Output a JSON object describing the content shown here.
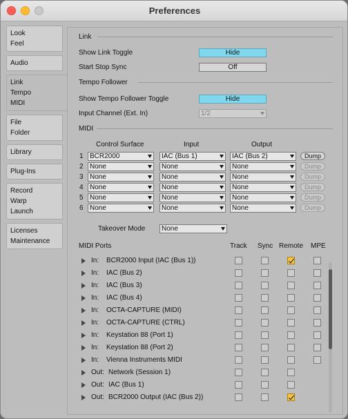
{
  "window": {
    "title": "Preferences"
  },
  "sidebar": {
    "tabs": [
      {
        "lines": [
          "Look",
          "Feel"
        ]
      },
      {
        "lines": [
          "Audio"
        ]
      },
      {
        "lines": [
          "Link",
          "Tempo",
          "MIDI"
        ],
        "active": true
      },
      {
        "lines": [
          "File",
          "Folder"
        ]
      },
      {
        "lines": [
          "Library"
        ]
      },
      {
        "lines": [
          "Plug-Ins"
        ]
      },
      {
        "lines": [
          "Record",
          "Warp",
          "Launch"
        ]
      },
      {
        "lines": [
          "Licenses",
          "Maintenance"
        ]
      }
    ]
  },
  "link": {
    "section": "Link",
    "show_link_toggle_label": "Show Link Toggle",
    "show_link_toggle_value": "Hide",
    "start_stop_sync_label": "Start Stop Sync",
    "start_stop_sync_value": "Off"
  },
  "tempo_follower": {
    "section": "Tempo Follower",
    "show_toggle_label": "Show Tempo Follower Toggle",
    "show_toggle_value": "Hide",
    "input_channel_label": "Input Channel (Ext. In)",
    "input_channel_value": "1/2"
  },
  "midi": {
    "section": "MIDI",
    "col_control_surface": "Control Surface",
    "col_input": "Input",
    "col_output": "Output",
    "dump_label": "Dump",
    "rows": [
      {
        "num": "1",
        "surface": "BCR2000",
        "input": "IAC (Bus 1)",
        "output": "IAC (Bus 2)",
        "dump_enabled": true
      },
      {
        "num": "2",
        "surface": "None",
        "input": "None",
        "output": "None",
        "dump_enabled": false
      },
      {
        "num": "3",
        "surface": "None",
        "input": "None",
        "output": "None",
        "dump_enabled": false
      },
      {
        "num": "4",
        "surface": "None",
        "input": "None",
        "output": "None",
        "dump_enabled": false
      },
      {
        "num": "5",
        "surface": "None",
        "input": "None",
        "output": "None",
        "dump_enabled": false
      },
      {
        "num": "6",
        "surface": "None",
        "input": "None",
        "output": "None",
        "dump_enabled": false
      }
    ],
    "takeover_label": "Takeover Mode",
    "takeover_value": "None"
  },
  "midi_ports": {
    "title": "MIDI Ports",
    "col_track": "Track",
    "col_sync": "Sync",
    "col_remote": "Remote",
    "col_mpe": "MPE",
    "ports": [
      {
        "dir": "In:",
        "name": "BCR2000 Input (IAC (Bus 1))",
        "remote": true,
        "has_mpe": true
      },
      {
        "dir": "In:",
        "name": "IAC (Bus 2)",
        "remote": false,
        "has_mpe": true
      },
      {
        "dir": "In:",
        "name": "IAC (Bus 3)",
        "remote": false,
        "has_mpe": true
      },
      {
        "dir": "In:",
        "name": "IAC (Bus 4)",
        "remote": false,
        "has_mpe": true
      },
      {
        "dir": "In:",
        "name": "OCTA-CAPTURE (MIDI)",
        "remote": false,
        "has_mpe": true
      },
      {
        "dir": "In:",
        "name": "OCTA-CAPTURE (CTRL)",
        "remote": false,
        "has_mpe": true
      },
      {
        "dir": "In:",
        "name": "Keystation 88 (Port 1)",
        "remote": false,
        "has_mpe": true
      },
      {
        "dir": "In:",
        "name": "Keystation 88 (Port 2)",
        "remote": false,
        "has_mpe": true
      },
      {
        "dir": "In:",
        "name": "Vienna Instruments MIDI",
        "remote": false,
        "has_mpe": true
      },
      {
        "dir": "Out:",
        "name": "Network (Session 1)",
        "remote": false,
        "has_mpe": false
      },
      {
        "dir": "Out:",
        "name": "IAC (Bus 1)",
        "remote": false,
        "has_mpe": false
      },
      {
        "dir": "Out:",
        "name": "BCR2000 Output (IAC (Bus 2))",
        "remote": true,
        "has_mpe": false
      }
    ]
  },
  "colors": {
    "toggle_on": "#7fd8ee",
    "check_on": "#f5c542"
  }
}
